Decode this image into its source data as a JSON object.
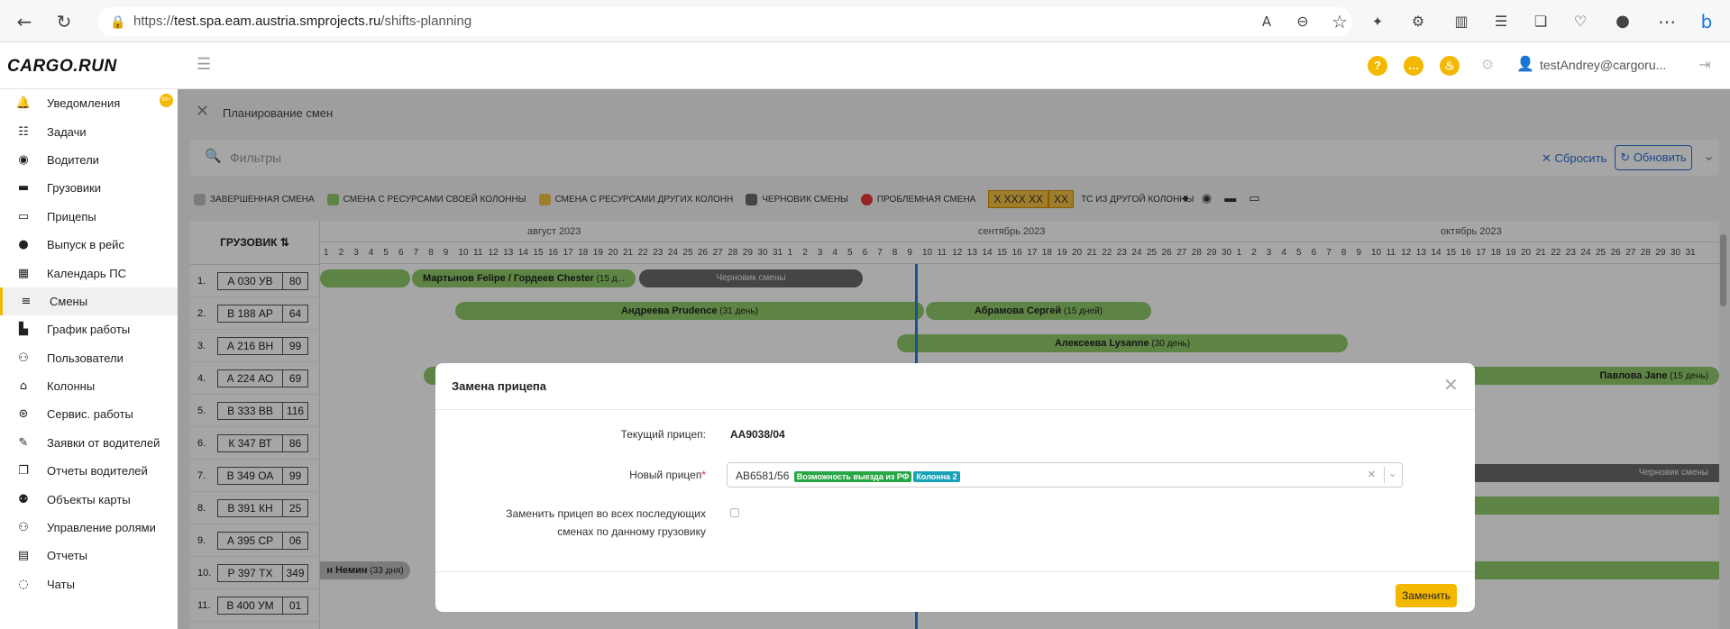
{
  "browser": {
    "url_prefix": "https://",
    "url_host": "test.spa.eam.austria.smprojects.ru",
    "url_path": "/shifts-planning"
  },
  "app": {
    "logo": "CARGO.RUN",
    "user": "testAndrey@cargoru..."
  },
  "sidebar": {
    "badge": "99+",
    "items": [
      {
        "label": "Уведомления",
        "icon": "bell-icon"
      },
      {
        "label": "Задачи",
        "icon": "tasks-icon"
      },
      {
        "label": "Водители",
        "icon": "steering-wheel-icon"
      },
      {
        "label": "Грузовики",
        "icon": "truck-icon"
      },
      {
        "label": "Прицепы",
        "icon": "trailer-icon"
      },
      {
        "label": "Выпуск в рейс",
        "icon": "user-release-icon"
      },
      {
        "label": "Календарь ПС",
        "icon": "calendar-icon"
      },
      {
        "label": "Смены",
        "icon": "shifts-icon"
      },
      {
        "label": "График работы",
        "icon": "chart-icon"
      },
      {
        "label": "Пользователи",
        "icon": "users-icon"
      },
      {
        "label": "Колонны",
        "icon": "garage-icon"
      },
      {
        "label": "Сервис. работы",
        "icon": "service-icon"
      },
      {
        "label": "Заявки от водителей",
        "icon": "brush-icon"
      },
      {
        "label": "Отчеты водителей",
        "icon": "copy-icon"
      },
      {
        "label": "Объекты карты",
        "icon": "map-objects-icon"
      },
      {
        "label": "Управление ролями",
        "icon": "roles-icon"
      },
      {
        "label": "Отчеты",
        "icon": "reports-icon"
      },
      {
        "label": "Чаты",
        "icon": "chat-icon"
      }
    ]
  },
  "page": {
    "title": "Планирование смен",
    "filter_placeholder": "Фильтры",
    "reset": "Сбросить",
    "refresh": "Обновить"
  },
  "legend": {
    "completed": "ЗАВЕРШЕННАЯ СМЕНА",
    "own": "СМЕНА С РЕСУРСАМИ СВОЕЙ КОЛОННЫ",
    "other": "СМЕНА С РЕСУРСАМИ ДРУГИХ КОЛОНН",
    "draft": "ЧЕРНОВИК СМЕНЫ",
    "problem": "ПРОБЛЕМНАЯ СМЕНА",
    "plate_main": "X XXX XX",
    "plate_reg": "XX",
    "other_column": "ТС ИЗ ДРУГОЙ КОЛОННЫ",
    "colors": {
      "completed": "#bdbdbd",
      "own": "#8fcb6a",
      "other": "#f5c242",
      "draft": "#6b6b6b",
      "problem": "#e53935"
    }
  },
  "grid": {
    "column_header": "ГРУЗОВИК",
    "months": [
      "август 2023",
      "сентябрь 2023",
      "октябрь 2023"
    ],
    "rows": [
      {
        "n": "1.",
        "plate": "А 030 УВ",
        "reg": "80"
      },
      {
        "n": "2.",
        "plate": "В 188 АР",
        "reg": "64"
      },
      {
        "n": "3.",
        "plate": "А 216 ВН",
        "reg": "99"
      },
      {
        "n": "4.",
        "plate": "А 224 АО",
        "reg": "69"
      },
      {
        "n": "5.",
        "plate": "В 333 ВВ",
        "reg": "116"
      },
      {
        "n": "6.",
        "plate": "К 347 ВТ",
        "reg": "86"
      },
      {
        "n": "7.",
        "plate": "В 349 ОА",
        "reg": "99"
      },
      {
        "n": "8.",
        "plate": "В 391 КН",
        "reg": "25"
      },
      {
        "n": "9.",
        "plate": "А 395 СР",
        "reg": "06"
      },
      {
        "n": "10.",
        "plate": "Р 397 ТХ",
        "reg": "349"
      },
      {
        "n": "11.",
        "plate": "В 400 УМ",
        "reg": "01"
      }
    ],
    "bars": {
      "r1b": "Мартынов Felipe  / Гордеев Chester",
      "r1b_d": "(15 д...",
      "r1c": "Черновик смены",
      "r2a": "Андреева Prudence",
      "r2a_d": "(31 день)",
      "r2b": "Абрамова Сергей",
      "r2b_d": "(15 дней)",
      "r3a": "Алексеева Lysanne",
      "r3a_d": "(30 день)",
      "r4b": "Павлова Jane",
      "r4b_d": "(15 день)",
      "r7": "Черновик смены",
      "r10": "н Немин",
      "r10_d": "(33 дня)"
    }
  },
  "modal": {
    "title": "Замена прицепа",
    "current_label": "Текущий прицеп:",
    "current_value": "АА9038/04",
    "new_label": "Новый прицеп",
    "new_value": "АВ6581/56",
    "tag1": "Возможность выезда из РФ",
    "tag2": "Колонна 2",
    "replace_all_label_1": "Заменить прицеп во всех последующих",
    "replace_all_label_2": "сменах по данному грузовику",
    "submit": "Заменить"
  }
}
